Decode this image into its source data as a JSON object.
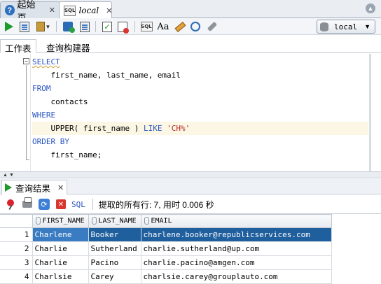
{
  "doc_tabs": [
    {
      "label": "起始页",
      "icon": "home-icon"
    },
    {
      "label": "local",
      "icon": "sql-worksheet-icon"
    }
  ],
  "toolbar": {
    "connection": "local"
  },
  "sub_tabs": [
    "工作表",
    "查询构建器"
  ],
  "editor": {
    "lines": [
      {
        "tokens": [
          {
            "t": "SELECT",
            "k": "kw-squig"
          }
        ]
      },
      {
        "tokens": [
          {
            "t": "    first_name, last_name, email",
            "k": ""
          }
        ]
      },
      {
        "tokens": [
          {
            "t": "FROM",
            "k": "kw"
          }
        ]
      },
      {
        "tokens": [
          {
            "t": "    contacts",
            "k": ""
          }
        ]
      },
      {
        "tokens": [
          {
            "t": "WHERE",
            "k": "kw"
          }
        ]
      },
      {
        "tokens": [
          {
            "t": "    UPPER( first_name ) ",
            "k": ""
          },
          {
            "t": "LIKE",
            "k": "kw"
          },
          {
            "t": " ",
            "k": ""
          },
          {
            "t": "'CH%'",
            "k": "str"
          }
        ],
        "highlight": true
      },
      {
        "tokens": [
          {
            "t": "ORDER BY",
            "k": "kw"
          }
        ]
      },
      {
        "tokens": [
          {
            "t": "    first_name;",
            "k": ""
          }
        ]
      }
    ]
  },
  "results": {
    "tab_label": "查询结果",
    "sql_label": "SQL",
    "status": "提取的所有行: 7, 用时 0.006 秒",
    "columns": [
      "FIRST_NAME",
      "LAST_NAME",
      "EMAIL"
    ],
    "rows": [
      [
        "1",
        "Charlene",
        "Booker",
        "charlene.booker@republicservices.com"
      ],
      [
        "2",
        "Charlie",
        "Sutherland",
        "charlie.sutherland@up.com"
      ],
      [
        "3",
        "Charlie",
        "Pacino",
        "charlie.pacino@amgen.com"
      ],
      [
        "4",
        "Charlsie",
        "Carey",
        "charlsie.carey@grouplauto.com"
      ]
    ]
  }
}
